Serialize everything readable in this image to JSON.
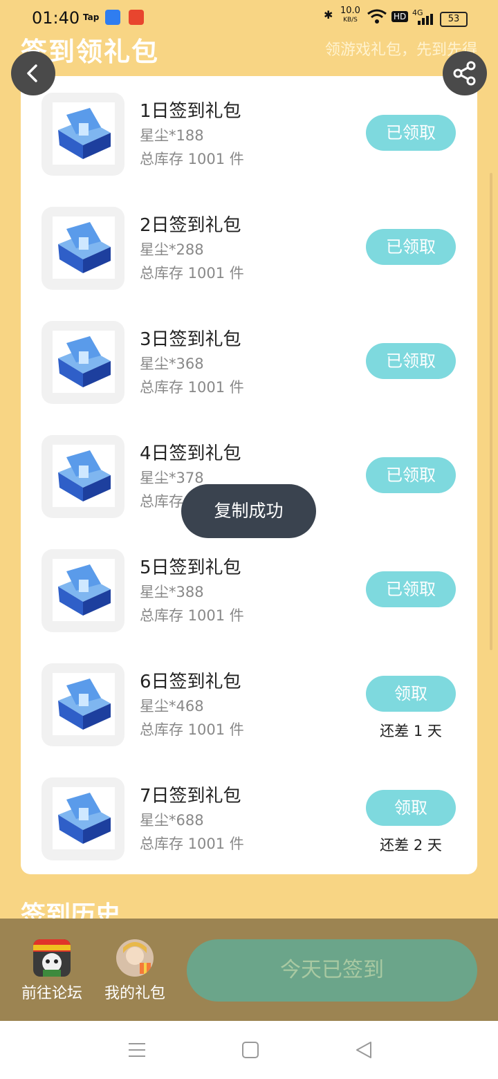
{
  "status_bar": {
    "time": "01:40",
    "apps": [
      "Tap"
    ],
    "network_speed": "10.0",
    "network_unit": "KB/S",
    "hd": "HD",
    "signal": "4G",
    "battery": "53"
  },
  "header": {
    "title": "签到领礼包",
    "subtitle": "领游戏礼包，先到先得"
  },
  "gifts": [
    {
      "name": "1日签到礼包",
      "desc": "星尘*188",
      "stock": "总库存 1001 件",
      "button": "已领取"
    },
    {
      "name": "2日签到礼包",
      "desc": "星尘*288",
      "stock": "总库存 1001 件",
      "button": "已领取"
    },
    {
      "name": "3日签到礼包",
      "desc": "星尘*368",
      "stock": "总库存 1001 件",
      "button": "已领取"
    },
    {
      "name": "4日签到礼包",
      "desc": "星尘*378",
      "stock": "总库存 1001 件",
      "button": "已领取"
    },
    {
      "name": "5日签到礼包",
      "desc": "星尘*388",
      "stock": "总库存 1001 件",
      "button": "已领取"
    },
    {
      "name": "6日签到礼包",
      "desc": "星尘*468",
      "stock": "总库存 1001 件",
      "button": "领取",
      "days_left": "还差 1 天"
    },
    {
      "name": "7日签到礼包",
      "desc": "星尘*688",
      "stock": "总库存 1001 件",
      "button": "领取",
      "days_left": "还差 2 天"
    }
  ],
  "toast": "复制成功",
  "history_title": "签到历史",
  "bottom_bar": {
    "forum_label": "前往论坛",
    "my_gifts_label": "我的礼包",
    "signed_button": "今天已签到"
  },
  "colors": {
    "background": "#F8D584",
    "claim_button": "#7ED9DE",
    "bottom_bar": "#9C8452",
    "signed_button": "#6BA58A",
    "toast": "#3A434F"
  }
}
